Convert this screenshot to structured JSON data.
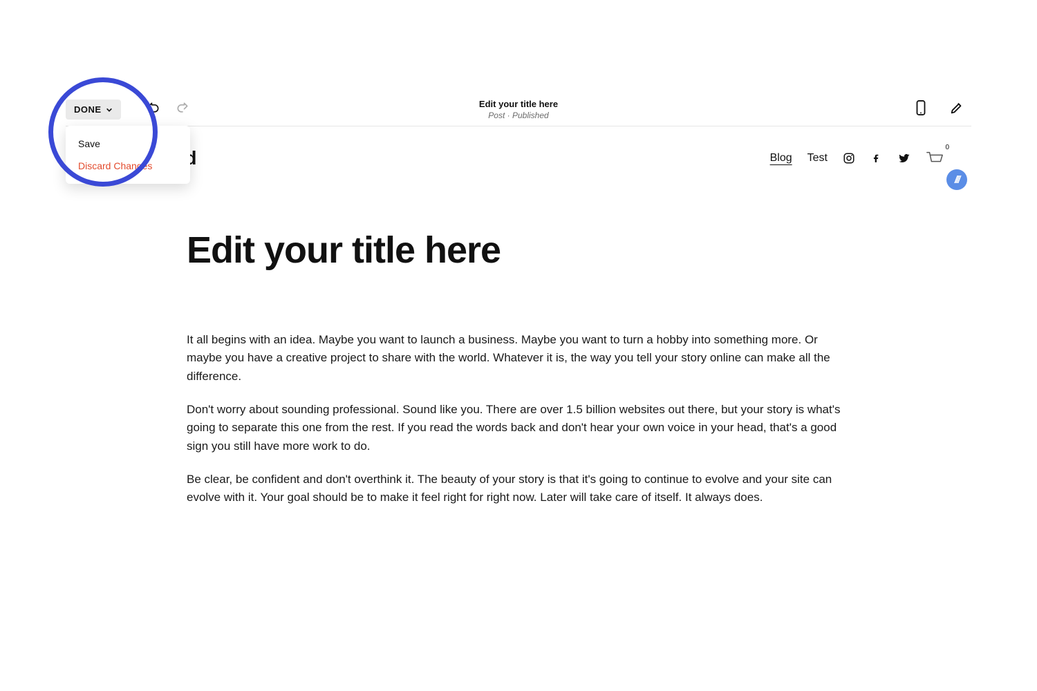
{
  "toolbar": {
    "done_label": "DONE",
    "dropdown": {
      "save_label": "Save",
      "discard_label": "Discard Changes"
    }
  },
  "page_header": {
    "title": "Edit your title here",
    "meta": "Post · Published"
  },
  "site_nav": {
    "logo": "Playground",
    "links": [
      "Blog",
      "Test"
    ],
    "active_index": 0,
    "cart_count": "0"
  },
  "post": {
    "title": "Edit your title here",
    "paragraphs": [
      "It all begins with an idea. Maybe you want to launch a business. Maybe you want to turn a hobby into something more. Or maybe you have a creative project to share with the world. Whatever it is, the way you tell your story online can make all the difference.",
      "Don't worry about sounding professional. Sound like you. There are over 1.5 billion websites out there, but your story is what's going to separate this one from the rest. If you read the words back and don't hear your own voice in your head, that's a good sign you still have more work to do.",
      "Be clear, be confident and don't overthink it. The beauty of your story is that it's going to continue to evolve and your site can evolve with it. Your goal should be to make it feel right for right now. Later will take care of itself. It always does."
    ]
  }
}
